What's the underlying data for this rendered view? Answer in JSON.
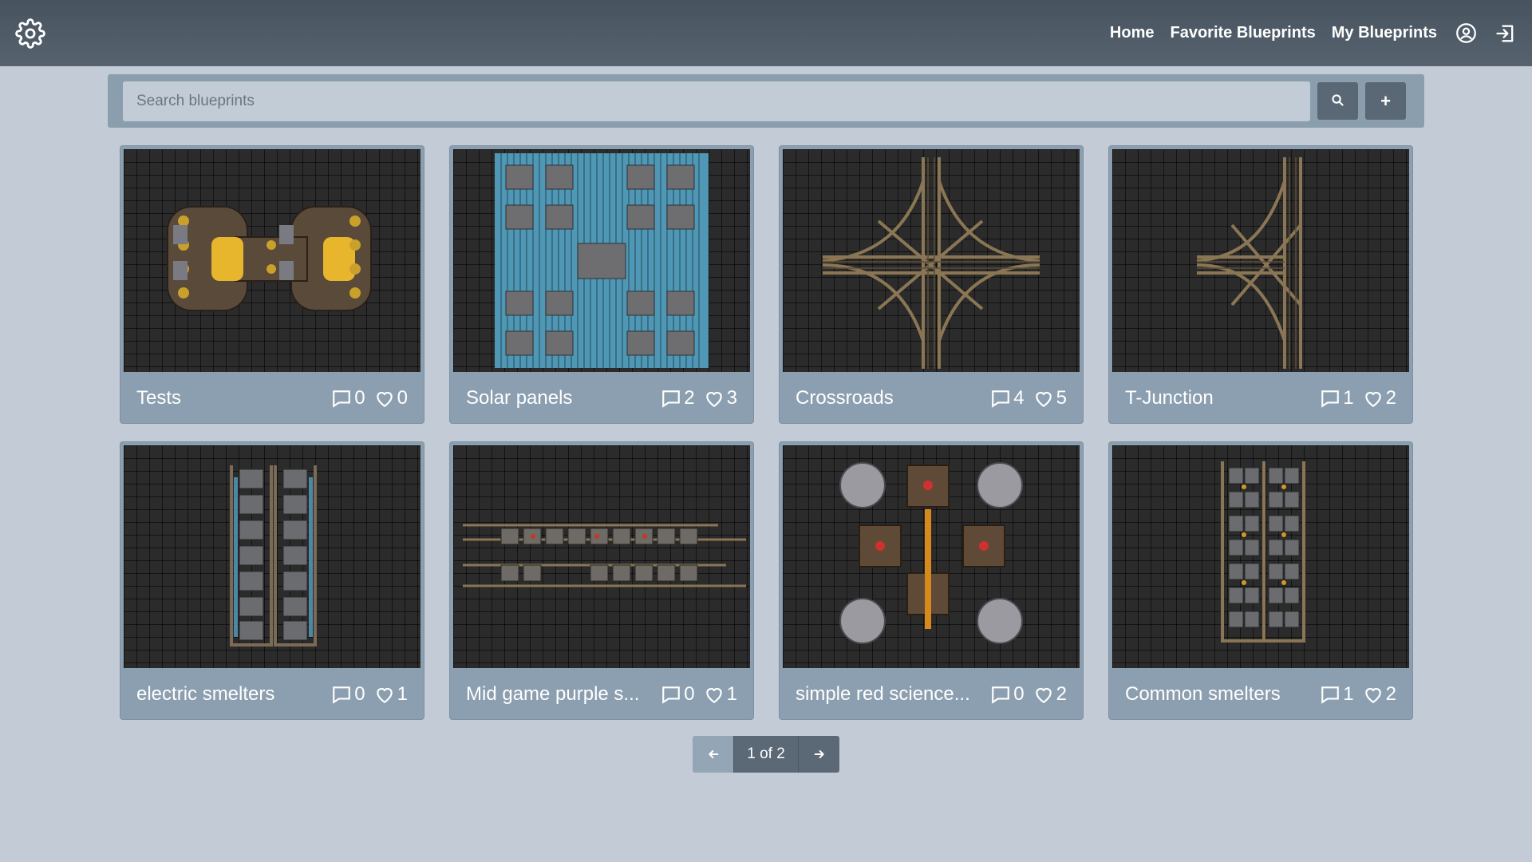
{
  "header": {
    "logo_icon": "gear-icon",
    "nav": [
      {
        "label": "Home"
      },
      {
        "label": "Favorite Blueprints"
      },
      {
        "label": "My Blueprints"
      }
    ],
    "account_icon": "user-circle-icon",
    "logout_icon": "logout-icon"
  },
  "search": {
    "placeholder": "Search blueprints",
    "value": "",
    "search_icon": "search-icon",
    "add_label": "+"
  },
  "blueprints": [
    {
      "title": "Tests",
      "comments": "0",
      "likes": "0",
      "thumb": "rocket-pair"
    },
    {
      "title": "Solar panels",
      "comments": "2",
      "likes": "3",
      "thumb": "solar"
    },
    {
      "title": "Crossroads",
      "comments": "4",
      "likes": "5",
      "thumb": "crossroads"
    },
    {
      "title": "T-Junction",
      "comments": "1",
      "likes": "2",
      "thumb": "tjunction"
    },
    {
      "title": "electric smelters",
      "comments": "0",
      "likes": "1",
      "thumb": "smelter-columns"
    },
    {
      "title": "Mid game purple s...",
      "comments": "0",
      "likes": "1",
      "thumb": "purple-line"
    },
    {
      "title": "simple red science...",
      "comments": "0",
      "likes": "2",
      "thumb": "red-science"
    },
    {
      "title": "Common smelters",
      "comments": "1",
      "likes": "2",
      "thumb": "common-smelters"
    }
  ],
  "pagination": {
    "prev_icon": "arrow-left-icon",
    "next_icon": "arrow-right-icon",
    "label": "1 of 2"
  },
  "colors": {
    "topbar": "#4f5b67",
    "background": "#c3ccd6",
    "card": "#8c9fb0",
    "button": "#5a6774"
  }
}
